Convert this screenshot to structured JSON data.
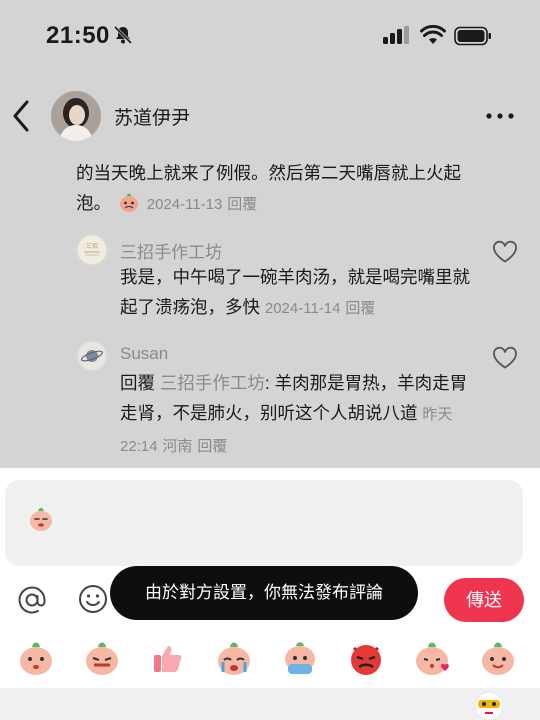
{
  "status_bar": {
    "time": "21:50"
  },
  "header": {
    "name": "苏道伊尹"
  },
  "comment": {
    "text": "的当天晚上就来了例假。然后第二天嘴唇就上火起泡。",
    "date": "2024-11-13",
    "reply_label": "回覆"
  },
  "replies": [
    {
      "name": "三招手作工坊",
      "text": "我是，中午喝了一碗羊肉汤，就是喝完嘴里就起了溃疡泡，多快",
      "date": "2024-11-14",
      "reply_label": "回覆"
    },
    {
      "name": "Susan",
      "reply_prefix": "回覆",
      "mention": "三招手作工坊",
      "text": ": 羊肉那是胃热，羊肉走胃走肾，不是肺火，别听这个人胡说八道",
      "date": "昨天 22:14",
      "location": "河南",
      "reply_label": "回覆"
    }
  ],
  "composer": {
    "toast": "由於對方設置，你無法發布評論",
    "send_label": "傳送"
  },
  "emoji_bar": [
    "peach-shy-emoji",
    "peach-laugh-emoji",
    "thumbs-up-emoji",
    "peach-tears-emoji",
    "peach-scared-emoji",
    "angry-red-emoji",
    "peach-kiss-emoji",
    "peach-smile-emoji"
  ],
  "colors": {
    "accent": "#f0364f",
    "toast_bg": "#0e0e0e",
    "overlay": "#d4d4d4"
  }
}
